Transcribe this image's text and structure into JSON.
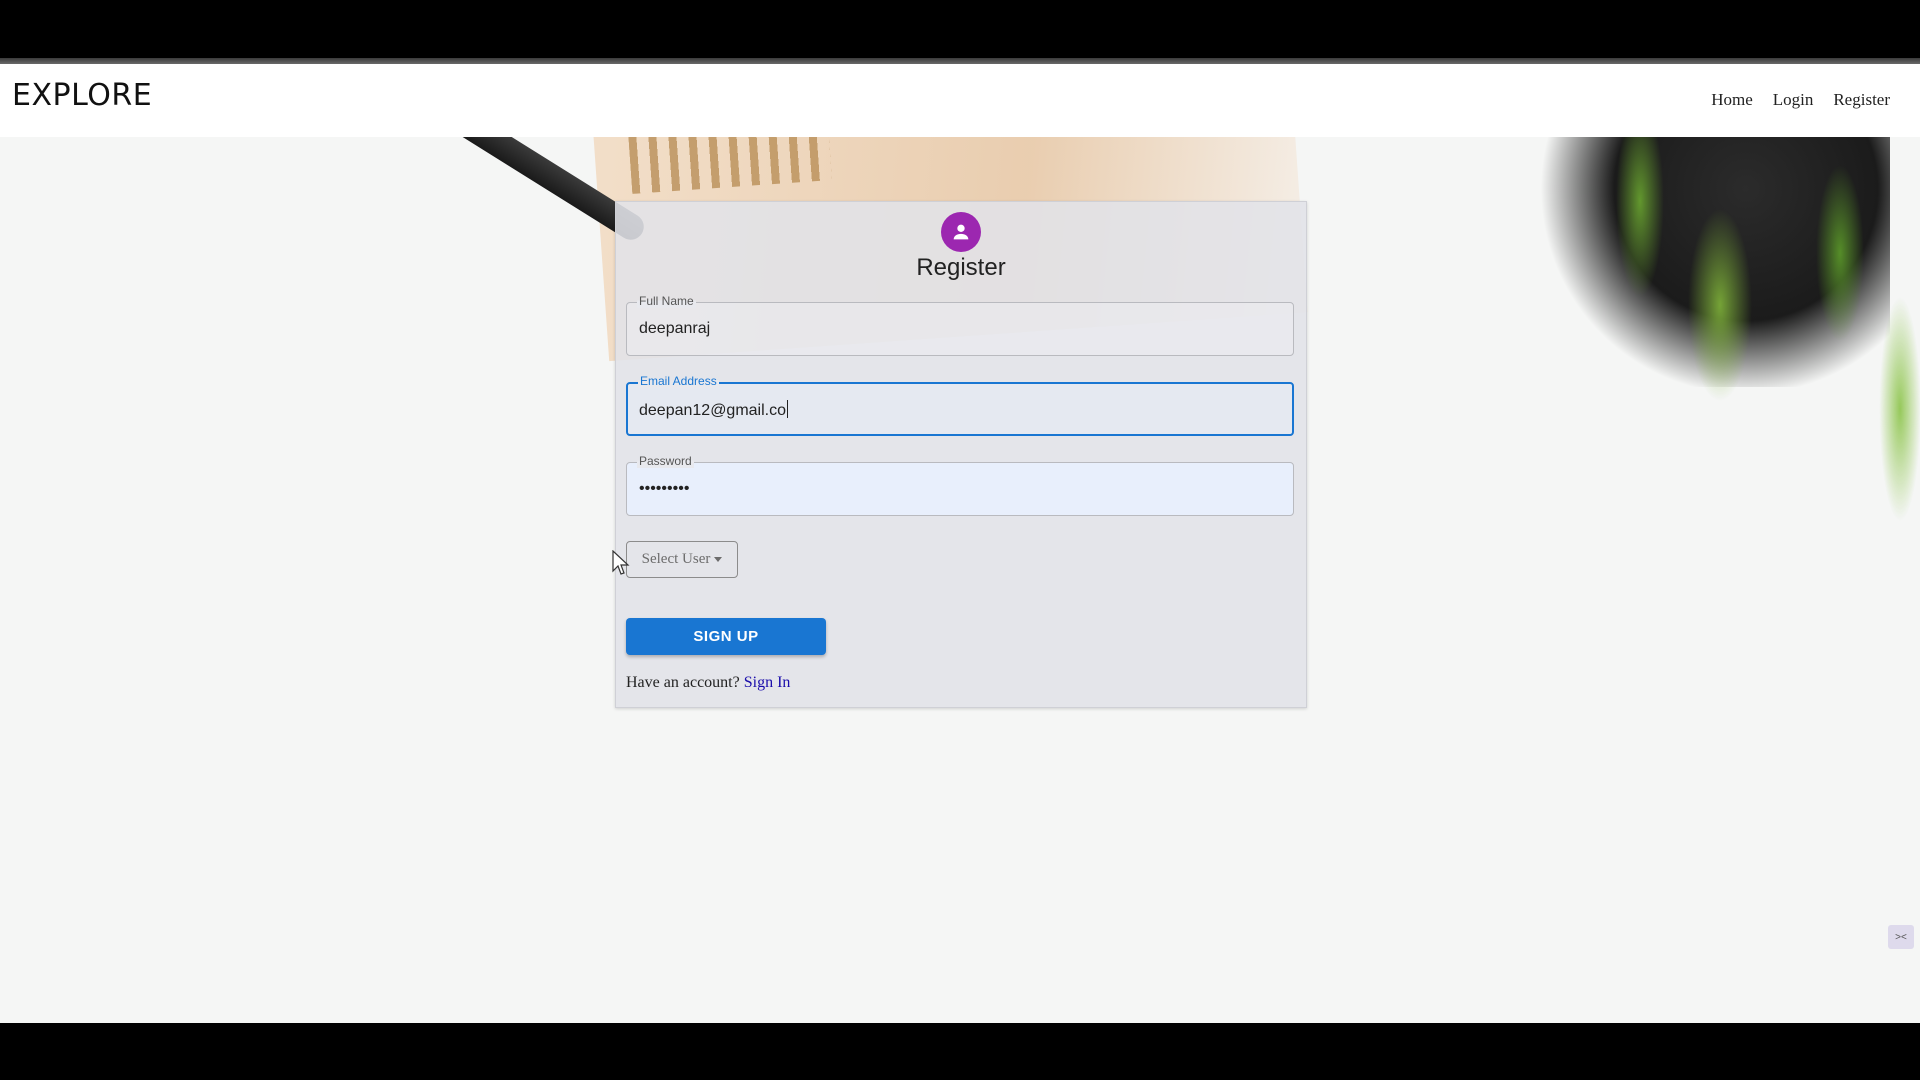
{
  "navbar": {
    "brand": "EXPLORE",
    "links": [
      "Home",
      "Login",
      "Register"
    ]
  },
  "register_card": {
    "title": "Register",
    "fields": [
      {
        "label": "Full Name",
        "value": "deepanraj"
      },
      {
        "label": "Email Address",
        "value": "deepan12@gmail.co"
      },
      {
        "label": "Password",
        "value": "•••••••••"
      }
    ],
    "select_user_label": "Select User",
    "signup_label": "SIGN UP",
    "account_prompt": "Have an account?",
    "signin_link": "Sign In"
  },
  "colors": {
    "primary": "#1976d2",
    "avatar": "#9c27b0",
    "link": "#1a0dab"
  },
  "icons": {
    "avatar": "person-icon",
    "select_caret": "caret-down-icon"
  }
}
